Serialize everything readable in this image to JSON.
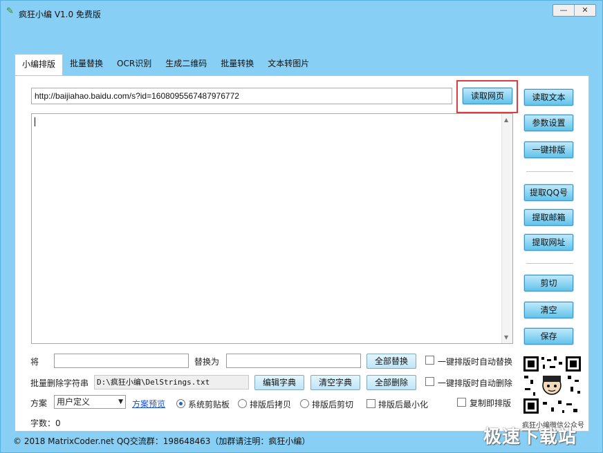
{
  "window": {
    "title": "疯狂小编 V1.0 免费版",
    "minimize": "—",
    "close": "✕"
  },
  "tabs": [
    "小编排版",
    "批量替换",
    "OCR识别",
    "生成二维码",
    "批量转换",
    "文本转图片"
  ],
  "url": {
    "value": "http://baijiahao.baidu.com/s?id=1608095567487976772"
  },
  "buttons": {
    "read_web": "读取网页",
    "read_text": "读取文本",
    "params": "参数设置",
    "one_key": "一键排版",
    "extract_qq": "提取QQ号",
    "extract_email": "提取邮箱",
    "extract_url": "提取网址",
    "cut": "剪切",
    "clear": "清空",
    "save": "保存",
    "replace_all": "全部替换",
    "edit_dict": "编辑字典",
    "clear_dict": "清空字典",
    "delete_all": "全部删除"
  },
  "replace": {
    "from_label": "将",
    "to_label": "替换为",
    "auto_label": "一键排版时自动替换"
  },
  "delete": {
    "label": "批量删除字符串",
    "file": "D:\\疯狂小编\\DelStrings.txt",
    "auto_label": "一键排版时自动删除"
  },
  "scheme": {
    "label": "方案",
    "selected": "用户定义",
    "preview_link": "方案预览",
    "radio_clipboard": "系统剪贴板",
    "radio_copy_after": "排版后拷贝",
    "radio_cut_after": "排版后剪切",
    "minimize_after": "排版后最小化",
    "copy_is_layout": "复制即排版"
  },
  "wordcount": "字数：0",
  "qr_caption": "疯狂小编微信公众号",
  "status_bar": "© 2018 MatrixCoder.net    QQ交流群：198648463（加群请注明：疯狂小编）",
  "watermark": "极速下载站"
}
